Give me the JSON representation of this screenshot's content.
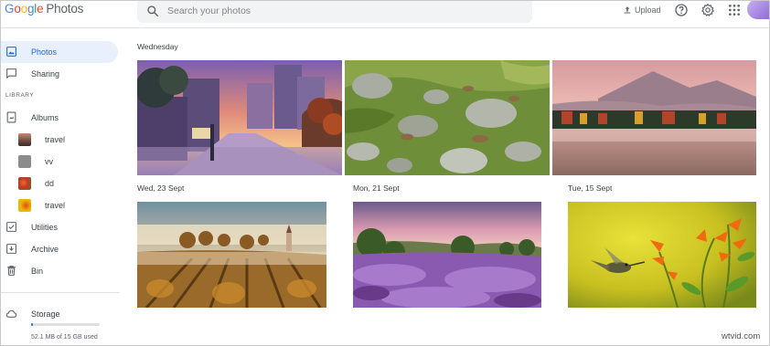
{
  "app": {
    "logo_google": [
      "G",
      "o",
      "o",
      "g",
      "l",
      "e"
    ],
    "logo_product": "Photos"
  },
  "header": {
    "search_placeholder": "Search your photos",
    "upload_label": "Upload",
    "icons": [
      "search-icon",
      "upload-icon",
      "help-icon",
      "settings-icon",
      "apps-grid-icon"
    ]
  },
  "sidebar": {
    "items": [
      {
        "label": "Photos",
        "icon": "photo-icon",
        "active": true
      },
      {
        "label": "Sharing",
        "icon": "chat-bubble-icon"
      }
    ],
    "library_label": "LIBRARY",
    "library_items": [
      {
        "label": "Albums",
        "icon": "album-icon"
      }
    ],
    "albums": [
      {
        "label": "travel",
        "color": "#8a5a4e"
      },
      {
        "label": "vv",
        "color": "#8c8c8c"
      },
      {
        "label": "dd",
        "color": "#c44a2a"
      },
      {
        "label": "travel",
        "color": "#e0b000"
      }
    ],
    "tools": [
      {
        "label": "Utilities",
        "icon": "utilities-icon"
      },
      {
        "label": "Archive",
        "icon": "archive-icon"
      },
      {
        "label": "Bin",
        "icon": "trash-icon"
      }
    ],
    "storage": {
      "label": "Storage",
      "icon": "cloud-icon",
      "usage_text": "52.1 MB of 15 GB used",
      "used_fraction": 0.0034
    }
  },
  "main": {
    "groups": [
      {
        "date": "Wednesday"
      },
      {
        "date": "Wed, 23 Sept"
      },
      {
        "date": "Mon, 21 Sept"
      },
      {
        "date": "Tue, 15 Sept"
      }
    ]
  },
  "watermark": "wtvid.com",
  "colors": {
    "accent": "#1a73e8",
    "active_bg": "#e8f0fe"
  }
}
